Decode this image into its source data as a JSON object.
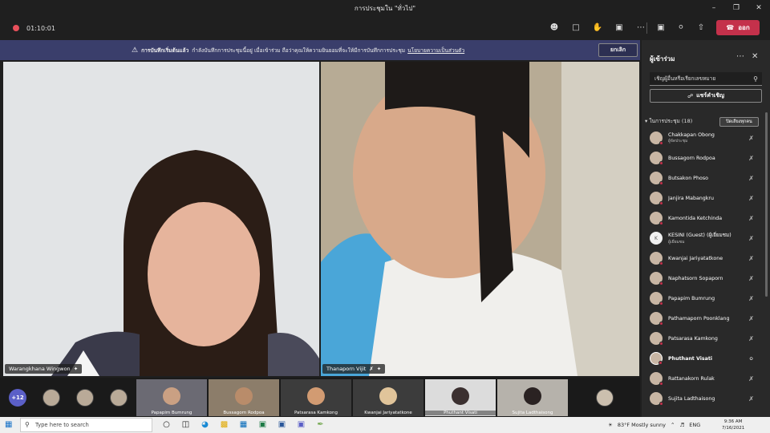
{
  "window": {
    "title": "การประชุมใน \"ทั่วไป\"",
    "controls": [
      "–",
      "❐",
      "✕"
    ]
  },
  "toolbar": {
    "timer": "01:10:01",
    "icons": [
      "people-icon",
      "chat-icon",
      "reactions-icon",
      "rooms-icon",
      "more-icon"
    ],
    "leave_label": "ออก",
    "accent": "#c4314b"
  },
  "banner": {
    "bold": "การบันทึกเริ่มต้นแล้ว",
    "message": "กำลังบันทึกการประชุมนี้อยู่ เมื่อเข้าร่วม ถือว่าคุณให้ความยินยอมที่จะให้มีการบันทึกการประชุม",
    "link": "นโยบายความเป็นส่วนตัว",
    "dismiss": "ยกเลิก"
  },
  "videos": [
    {
      "name": "Warangkhana Wingwon"
    },
    {
      "name": "Thanaporn Vijit"
    }
  ],
  "strip": {
    "more": "+12",
    "thumbs": [
      {
        "name": "Papapim Bumrung"
      },
      {
        "name": "Bussagorn Rodpoa"
      },
      {
        "name": "Patsarasa Kamkong"
      },
      {
        "name": "Kwanjai Jariyatatkone"
      },
      {
        "name": "Phuthant Visati"
      },
      {
        "name": "Sujita Ladthaisong"
      }
    ]
  },
  "panel": {
    "title": "ผู้เข้าร่วม",
    "invite_placeholder": "เชิญผู้อื่นหรือเรียกเลขหมาย",
    "share_label": "แชร์คำเชิญ",
    "section": "ในการประชุม (18)",
    "mute_all": "ปิดเสียงทุกคน",
    "participants": [
      {
        "name": "Chakkapan Obong",
        "sub": "ผู้จัดประชุม",
        "mic": "muted"
      },
      {
        "name": "Bussagorn Rodpoa",
        "sub": "",
        "mic": "muted"
      },
      {
        "name": "Butsakon Phoso",
        "sub": "",
        "mic": "muted"
      },
      {
        "name": "Janjira Mabangkru",
        "sub": "",
        "mic": "muted"
      },
      {
        "name": "Kamontida Ketchinda",
        "sub": "",
        "mic": "muted"
      },
      {
        "name": "KESINI (Guest) (ผู้เยี่ยมชม)",
        "sub": "ผู้เยี่ยมชม",
        "mic": "muted",
        "initial": "K"
      },
      {
        "name": "Kwanjai Jariyatatkone",
        "sub": "",
        "mic": "muted"
      },
      {
        "name": "Naphatsorn Sopaporn",
        "sub": "",
        "mic": "muted"
      },
      {
        "name": "Papapim Bumrung",
        "sub": "",
        "mic": "muted"
      },
      {
        "name": "Pathamaporn Poonklang",
        "sub": "",
        "mic": "muted"
      },
      {
        "name": "Patsarasa Kamkong",
        "sub": "",
        "mic": "muted"
      },
      {
        "name": "Phuthant Visati",
        "sub": "",
        "mic": "on",
        "active": true
      },
      {
        "name": "Rattanakorn Rulak",
        "sub": "",
        "mic": "muted"
      },
      {
        "name": "Sujita Ladthaisong",
        "sub": "",
        "mic": "muted"
      }
    ]
  },
  "taskbar": {
    "search_placeholder": "Type here to search",
    "weather": "83°F  Mostly sunny",
    "lang": "ENG",
    "time": "9:36 AM",
    "date": "7/16/2021"
  }
}
